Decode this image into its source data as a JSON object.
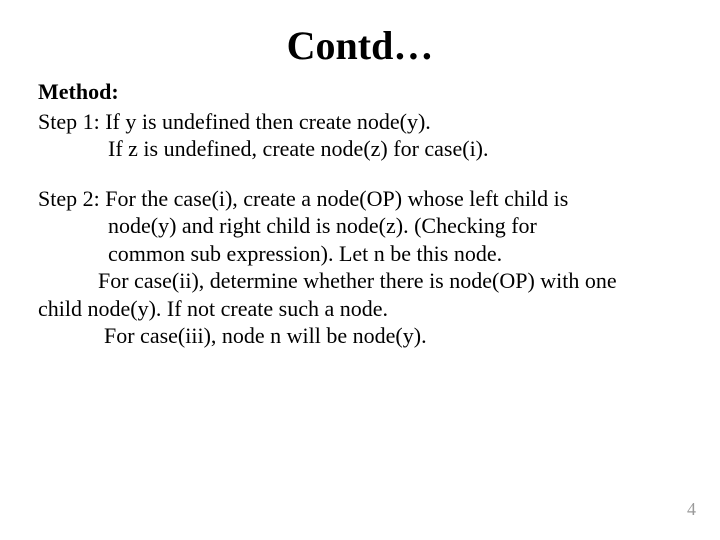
{
  "slide": {
    "title": "Contd…",
    "method_label": "Method:",
    "step1": {
      "line1": "Step 1: If y is undefined then create node(y).",
      "line2": "If z is undefined, create node(z) for case(i)."
    },
    "step2": {
      "line1": "Step 2: For the case(i), create a node(OP) whose left child is",
      "line2": "node(y) and right child is node(z). (Checking for",
      "line3": "common sub expression). Let n be this node.",
      "line4": "For case(ii), determine whether there is node(OP) with one",
      "line5": "child node(y). If not create such a node.",
      "line6": "For case(iii), node n will be node(y)."
    },
    "page_number": "4"
  }
}
